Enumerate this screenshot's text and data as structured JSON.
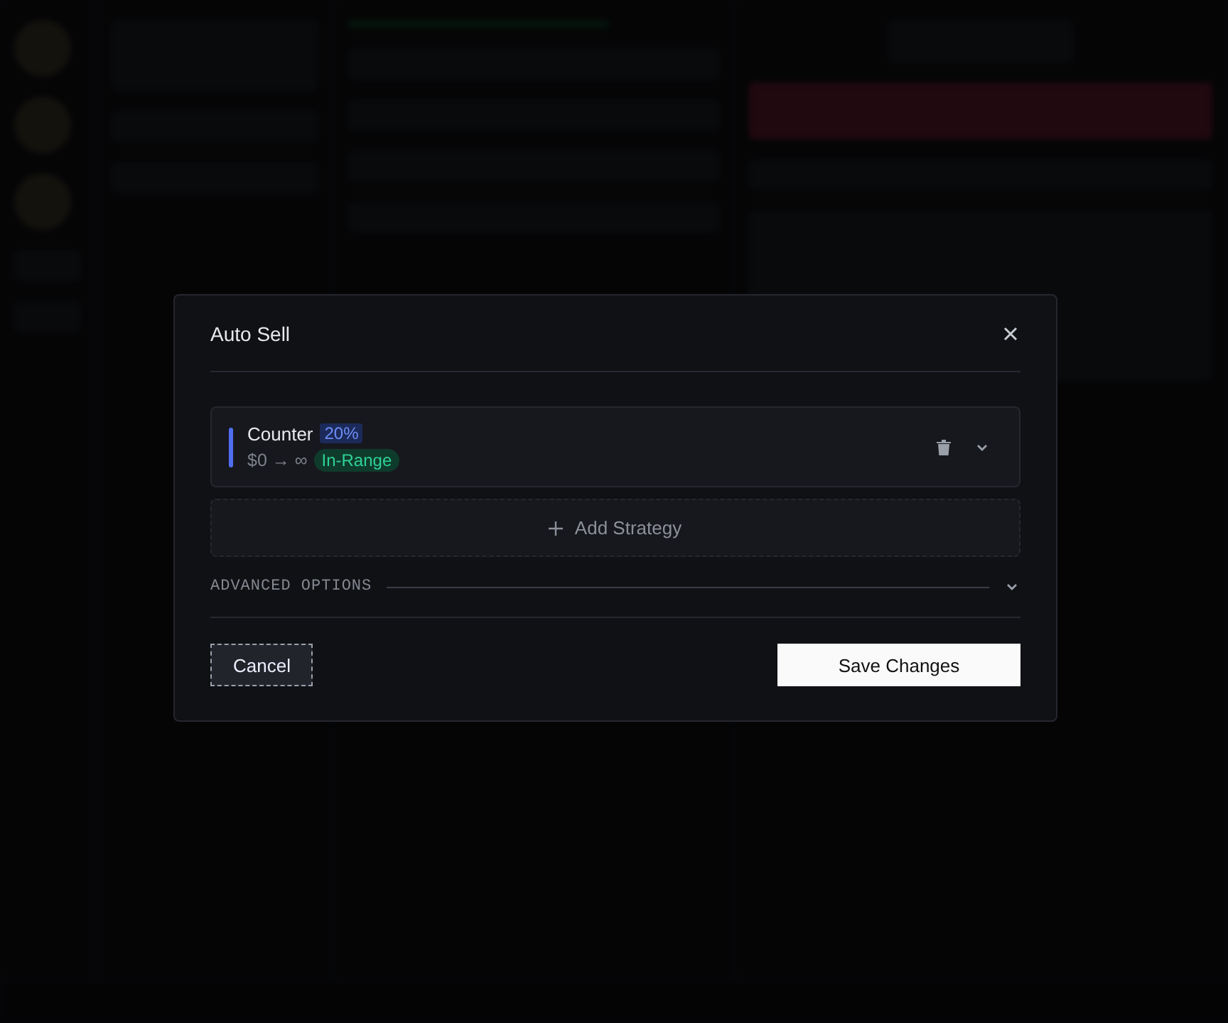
{
  "dialog": {
    "title": "Auto Sell",
    "strategies": [
      {
        "name": "Counter",
        "percent": "20%",
        "range": "$0 → ∞",
        "status": "In-Range",
        "expanded": false
      }
    ],
    "add_button": "Add Strategy",
    "advanced_options": {
      "label": "ADVANCED OPTIONS",
      "expanded": false
    },
    "buttons": [
      {
        "label": "Cancel",
        "kind": "secondary"
      },
      {
        "label": "Save Changes",
        "kind": "primary"
      }
    ]
  }
}
